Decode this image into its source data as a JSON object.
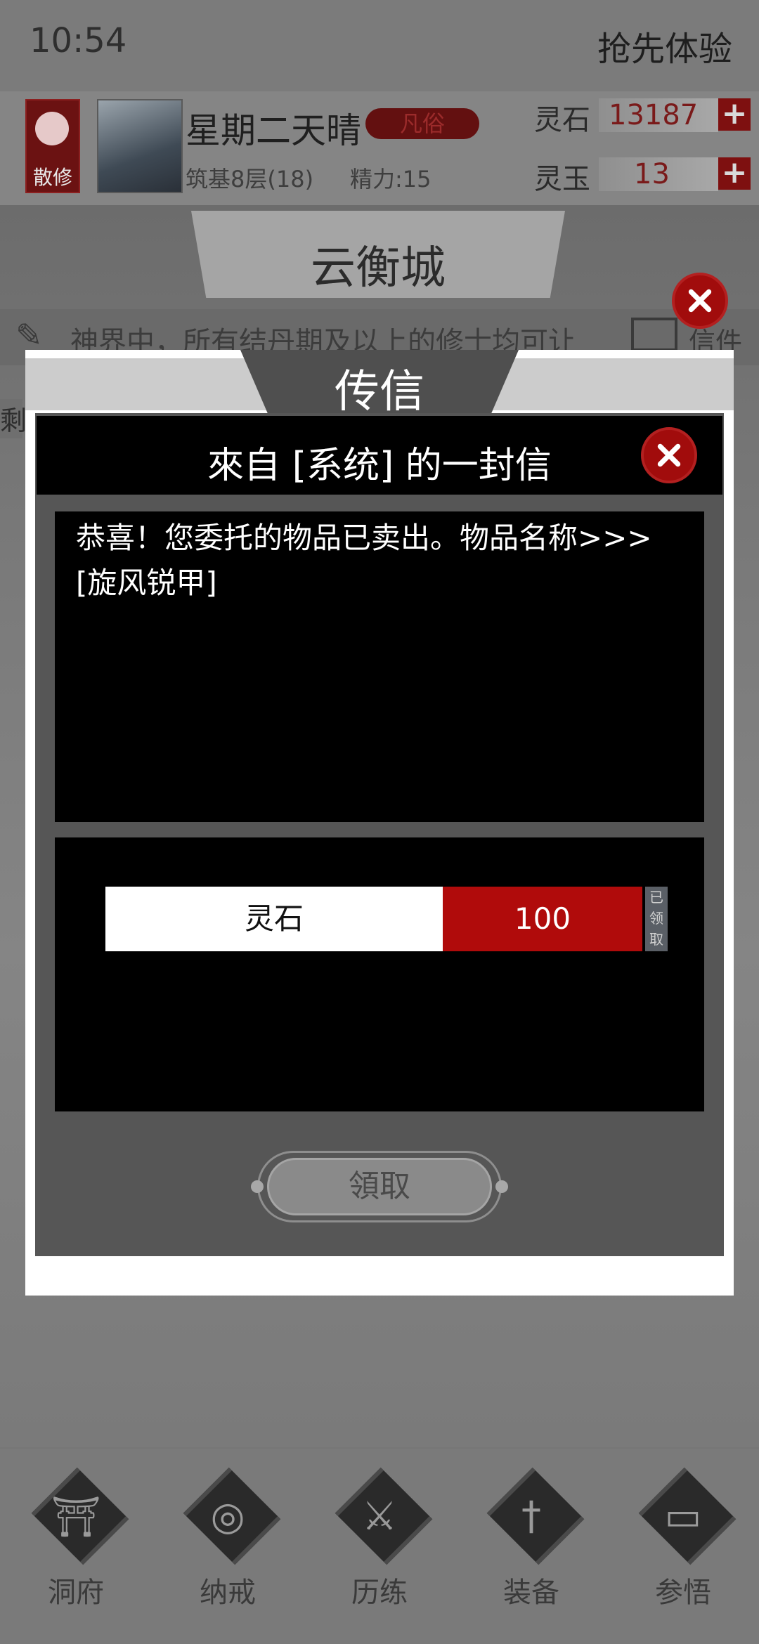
{
  "status_bar": {
    "time": "10:54",
    "trial_link": "抢先体验"
  },
  "player": {
    "sect_label": "散修",
    "name": "星期二天晴",
    "rank": "凡俗",
    "realm": "筑基8层(18)",
    "energy": "精力:15"
  },
  "currencies": [
    {
      "label": "灵石",
      "value": "13187",
      "plus": "+"
    },
    {
      "label": "灵玉",
      "value": "13",
      "plus": "+"
    }
  ],
  "location": {
    "city": "云衡城"
  },
  "ticker": {
    "left_fragment": "剩",
    "text": "神界中，所有结丹期及以上的修士均可让",
    "mail_label": "信件"
  },
  "dialog": {
    "title": "传信",
    "letter_title": "來自 [系统] 的一封信",
    "message": "恭喜！您委托的物品已卖出。物品名称>>>[旋风锐甲]",
    "reward": {
      "name": "灵石",
      "amount": "100",
      "claimed": "已领取"
    },
    "claim_button": "領取"
  },
  "bottom_nav": [
    {
      "label": "洞府",
      "icon": "gate-icon"
    },
    {
      "label": "纳戒",
      "icon": "ring-icon"
    },
    {
      "label": "历练",
      "icon": "crossed-swords-icon"
    },
    {
      "label": "装备",
      "icon": "sword-icon"
    },
    {
      "label": "参悟",
      "icon": "book-icon"
    }
  ],
  "colors": {
    "accent_red": "#b00b0b",
    "close_red": "#a10c0c"
  }
}
